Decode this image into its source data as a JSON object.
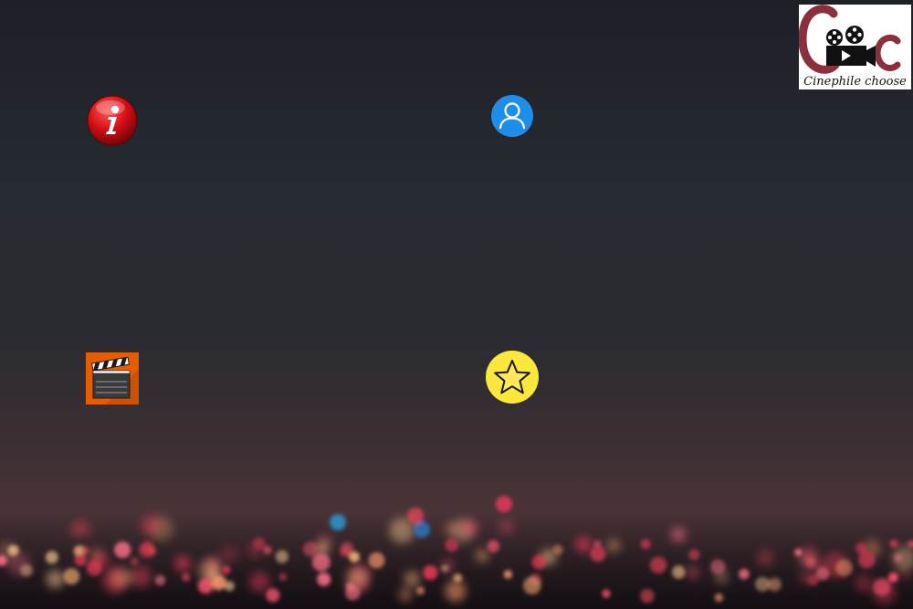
{
  "desktop": {
    "icons": [
      {
        "name": "info",
        "icon": "info-icon",
        "color": "#d40f14"
      },
      {
        "name": "profile",
        "icon": "user-icon",
        "color": "#2196f3"
      },
      {
        "name": "movies",
        "icon": "clapperboard-icon",
        "color": "#e65c00"
      },
      {
        "name": "favorites",
        "icon": "star-icon",
        "color": "#fbe83c"
      }
    ]
  },
  "logo": {
    "caption": "Cinephile choose",
    "icon": "film-camera-icon",
    "accent_color": "#8a2f3b"
  }
}
